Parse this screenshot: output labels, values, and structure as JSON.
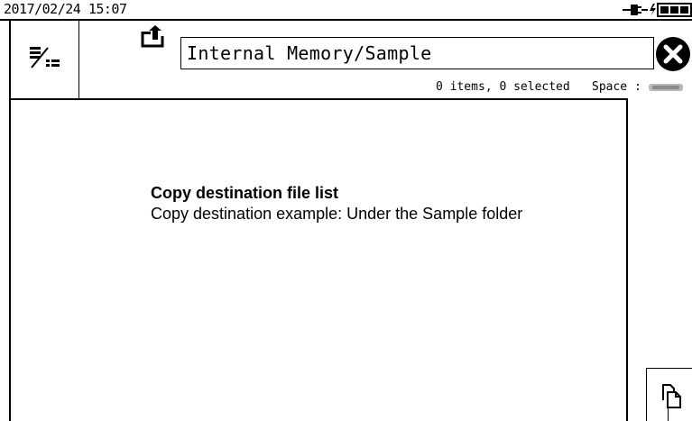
{
  "status_bar": {
    "datetime": "2017/02/24 15:07",
    "icons": [
      "ac-power-icon",
      "charging-icon",
      "battery-full-icon"
    ]
  },
  "header": {
    "menu_icon": "sort-menu-icon",
    "upload_icon": "parent-folder-icon",
    "path": "Internal Memory/Sample",
    "close_icon": "close-icon",
    "items_info": "0 items, 0 selected",
    "space_label": "Space :"
  },
  "list": {
    "caption_title": "Copy destination file list",
    "caption_text": "Copy destination example: Under the Sample folder"
  },
  "actions": {
    "copy_icon": "copy-icon"
  }
}
